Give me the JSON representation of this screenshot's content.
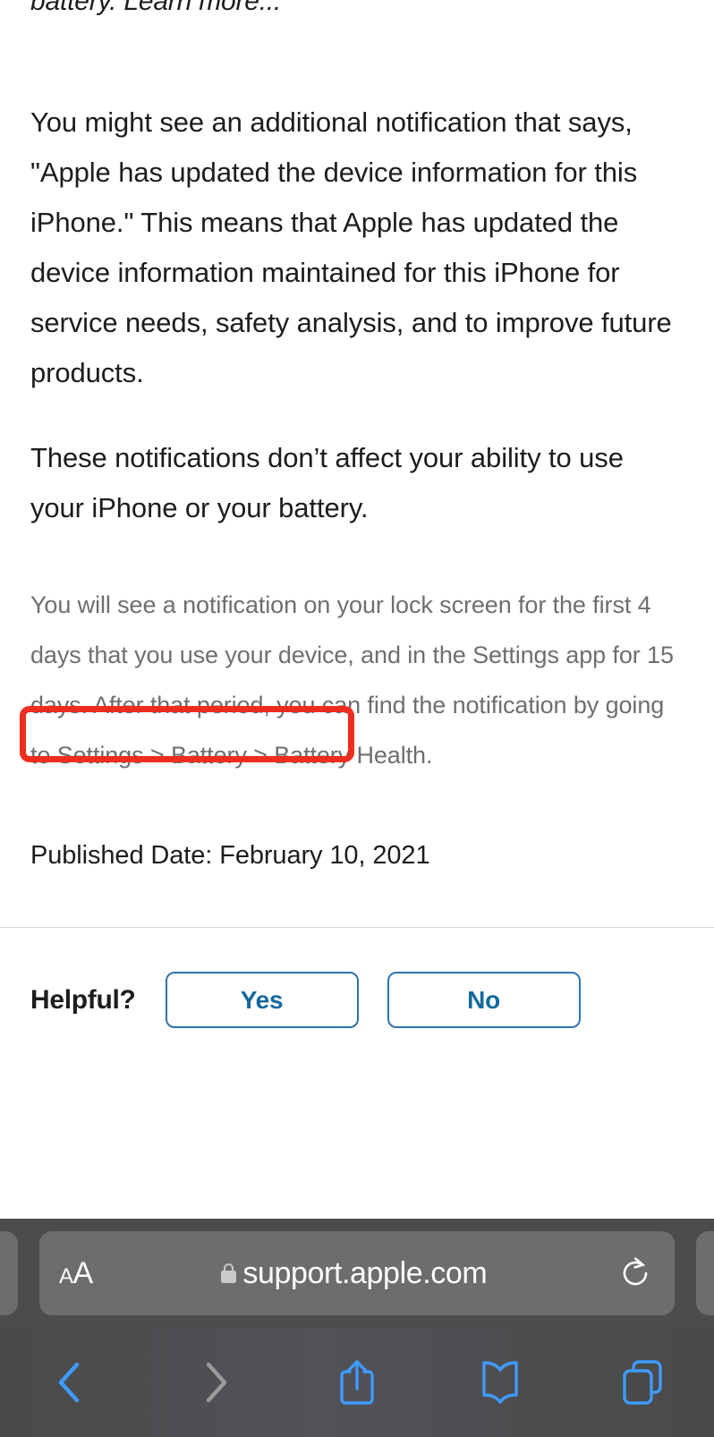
{
  "article": {
    "clipped_line": "battery. Learn more...",
    "paragraph_1": "You might see an additional notification that says, \"Apple has updated the device information for this iPhone.\" This means that Apple has updated the device information maintained for this iPhone for service needs, safety analysis, and to improve future products.",
    "paragraph_2": "These notifications don’t affect your ability to use your iPhone or your battery.",
    "note": "You will see a notification on your lock screen for the first 4 days that you use your device, and in the Settings app for 15 days. After that period, you can find the notification by going to Settings > Battery > Battery Health.",
    "published_date": "Published Date: February 10, 2021"
  },
  "annotation": {
    "highlight_color": "#ee2d1f",
    "highlighted_text": "Settings app for 15 days."
  },
  "feedback": {
    "label": "Helpful?",
    "yes_label": "Yes",
    "no_label": "No",
    "accent_color": "#14689e"
  },
  "browser": {
    "text_size_small": "A",
    "text_size_large": "A",
    "lock_icon": "lock-icon",
    "url": "support.apple.com",
    "reload_icon": "reload-icon",
    "toolbar": [
      {
        "name": "back-button",
        "icon": "chevron-left-icon",
        "enabled": true
      },
      {
        "name": "forward-button",
        "icon": "chevron-right-icon",
        "enabled": false
      },
      {
        "name": "share-button",
        "icon": "share-icon",
        "enabled": true
      },
      {
        "name": "bookmarks-button",
        "icon": "book-icon",
        "enabled": true
      },
      {
        "name": "tabs-button",
        "icon": "tabs-icon",
        "enabled": true
      }
    ],
    "accent_color": "#3f9bfd",
    "disabled_color": "#9a9a9a"
  }
}
